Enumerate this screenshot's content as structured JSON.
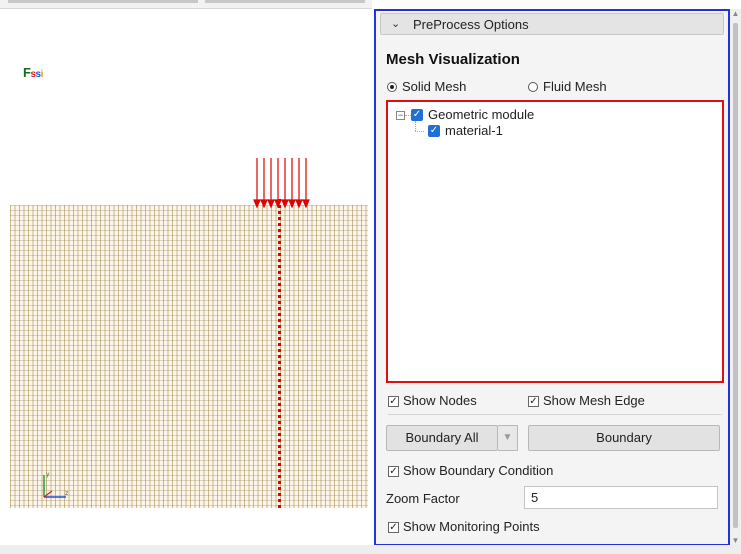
{
  "logo": {
    "text_f": "F",
    "text_s1": "s",
    "text_s2": "s",
    "text_i": "i"
  },
  "panel": {
    "header_title": "PreProcess Options",
    "section_title": "Mesh Visualization",
    "radio_solid": "Solid Mesh",
    "radio_fluid": "Fluid Mesh",
    "selected_mesh": "Solid Mesh",
    "tree": {
      "root_label": "Geometric module",
      "child_label": "material-1",
      "root_checked": true,
      "child_checked": true
    },
    "show_nodes": "Show Nodes",
    "show_mesh_edge": "Show Mesh Edge",
    "boundary_all": "Boundary All",
    "boundary": "Boundary",
    "show_boundary_condition": "Show Boundary Condition",
    "zoom_label": "Zoom Factor",
    "zoom_value": "5",
    "show_monitoring_points": "Show Monitoring Points"
  },
  "colors": {
    "panel_border": "#2432d6",
    "tree_border": "#e01010",
    "checkbox_accent": "#1f6fd6",
    "load_arrows": "#e00000",
    "mesh_fill": "#fbf6e9"
  },
  "icons": [
    "chevron-down-icon",
    "tree-collapse-icon",
    "checkbox-checked-icon",
    "axis-triad-icon",
    "scroll-up-icon",
    "scroll-down-icon",
    "dropdown-arrow-icon"
  ]
}
